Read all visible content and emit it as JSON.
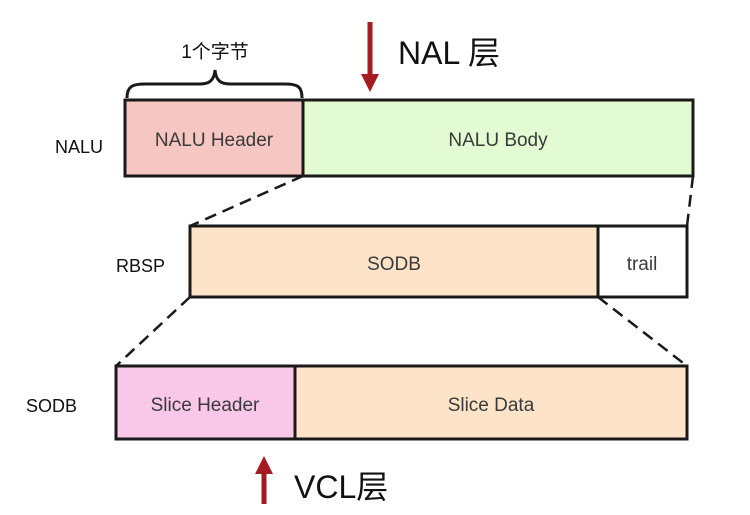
{
  "top_layer": {
    "label": "NAL 层"
  },
  "brace": {
    "label": "1个字节"
  },
  "nalu": {
    "row_label": "NALU",
    "header": "NALU Header",
    "body": "NALU Body"
  },
  "rbsp": {
    "row_label": "RBSP",
    "sodb": "SODB",
    "trail": "trail"
  },
  "sodb": {
    "row_label": "SODB",
    "slice_header": "Slice Header",
    "slice_data": "Slice Data"
  },
  "bottom_layer": {
    "label": "VCL层"
  },
  "colors": {
    "nalu_header_fill": "#f6c6c3",
    "nalu_body_fill": "#e3fbd3",
    "sodb_fill": "#fde3c8",
    "trail_fill": "#ffffff",
    "slice_header_fill": "#f9c7e8",
    "arrow": "#a51b22",
    "stroke": "#1a1a1a"
  }
}
